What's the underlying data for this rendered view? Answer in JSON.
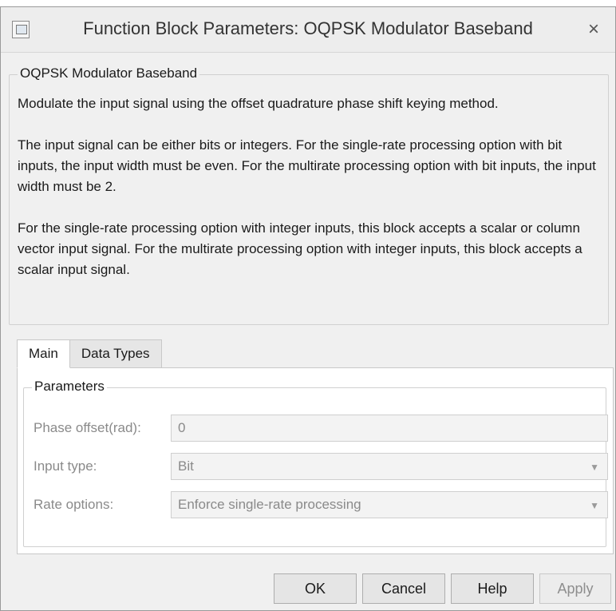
{
  "window": {
    "title": "Function Block Parameters: OQPSK Modulator Baseband",
    "close_glyph": "×"
  },
  "description": {
    "group_title": "OQPSK Modulator Baseband",
    "paragraphs": [
      "Modulate the input signal using the offset quadrature phase shift keying method.",
      "The input signal can be either bits or integers. For the single-rate processing option with bit inputs, the input width must be even. For the multirate processing option with bit inputs, the input width must be 2.",
      "For the single-rate processing option with integer inputs, this block accepts a scalar or column vector input signal. For the multirate processing option with integer inputs, this block accepts a scalar input signal."
    ]
  },
  "tabs": [
    {
      "label": "Main",
      "active": true
    },
    {
      "label": "Data Types",
      "active": false
    }
  ],
  "parameters": {
    "group_title": "Parameters",
    "phase_offset": {
      "label": "Phase offset(rad):",
      "value": "0"
    },
    "input_type": {
      "label": "Input type:",
      "value": "Bit"
    },
    "rate_options": {
      "label": "Rate options:",
      "value": "Enforce single-rate processing"
    }
  },
  "buttons": {
    "ok": "OK",
    "cancel": "Cancel",
    "help": "Help",
    "apply": "Apply"
  },
  "icons": {
    "app": "block-parameters-icon",
    "dropdown": "chevron-down-icon"
  }
}
